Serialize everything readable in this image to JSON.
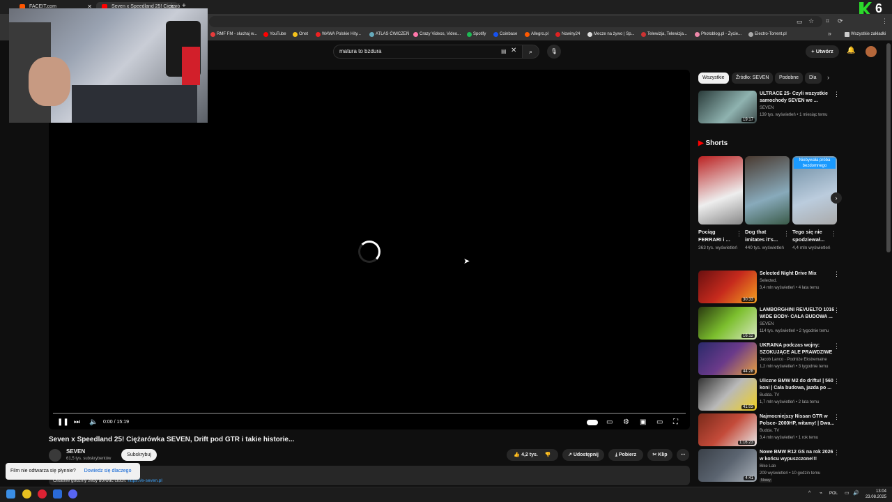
{
  "colors": {
    "accent": "#ff0000",
    "link": "#3ea6ff",
    "bg": "#0f0f0f"
  },
  "browser": {
    "tabs": [
      {
        "label": "FACEIT.com",
        "color": "#ff5500",
        "active": false
      },
      {
        "label": "Seven x Speedland 25! Ciężaró",
        "color": "#ff0000",
        "active": true
      }
    ],
    "new_tab": "+",
    "bookmarks": [
      {
        "label": "RMF FM - słuchaj w...",
        "color": "#e63b3b"
      },
      {
        "label": "YouTube",
        "color": "#ff0000"
      },
      {
        "label": "Onet",
        "color": "#f4c21b"
      },
      {
        "label": "WAWA Polskie Hity...",
        "color": "#e22"
      },
      {
        "label": "ATLAS ĆWICZEŃ",
        "color": "#6ab"
      },
      {
        "label": "Crazy Videos, Video...",
        "color": "#f7a"
      },
      {
        "label": "Spotify",
        "color": "#1db954"
      },
      {
        "label": "Coinbase",
        "color": "#1652f0"
      },
      {
        "label": "Allegro.pl",
        "color": "#ff5a00"
      },
      {
        "label": "Nowiny24",
        "color": "#d22"
      },
      {
        "label": "Mecze na żywo | Sp...",
        "color": "#ddd"
      },
      {
        "label": "Telewizja, Telewizja...",
        "color": "#c33"
      },
      {
        "label": "Photoblog.pl - Życie...",
        "color": "#e8a"
      },
      {
        "label": "Electro-Torrent.pl",
        "color": "#aaa"
      }
    ],
    "all_bookmarks": "Wszystkie zakładki"
  },
  "youtube": {
    "search_query": "matura to bzdura",
    "create_label": "Utwórz",
    "video": {
      "time": "0:00 / 15:19",
      "title": "Seven x Speedland 25! Ciężarówka SEVEN, Drift pod GTR i takie historie...",
      "channel": "SEVEN",
      "subscribers": "61,5 tys. subskrybentów",
      "subscribe": "Subskrybuj",
      "likes": "4,2 tys.",
      "share": "Udostępnij",
      "download": "Pobierz",
      "clip": "Klip",
      "description": "Ostatnie godziny żeby dorwać ciuch:",
      "description_link": "https://e-seven.pl"
    },
    "toast": {
      "text": "Film nie odtwarza się płynnie?",
      "link": "Dowiedz się dlaczego"
    },
    "chips": [
      "Wszystkie",
      "Źródło: SEVEN",
      "Podobne",
      "Dla"
    ],
    "top_video": {
      "title": "ULTRACE 25- Czyli wszystkie samochody SEVEN we ...",
      "channel": "SEVEN",
      "meta": "139 tys. wyświetleń • 1 miesiąc temu",
      "duration": "19:17"
    },
    "shorts_heading": "Shorts",
    "shorts": [
      {
        "title": "Pociąg FERRARI i ...",
        "meta": "363 tys. wyświetleń",
        "overlay": ""
      },
      {
        "title": "Dog that imitates it's...",
        "meta": "440 tys. wyświetleń",
        "overlay": ""
      },
      {
        "title": "Tego się nie spodziewał...",
        "meta": "4,4 mln wyświetleń",
        "overlay": "Niebywała próba bezdomnego"
      }
    ],
    "videos": [
      {
        "title": "Selected Night Drive Mix",
        "channel": "Selected.",
        "meta": "3,4 mln wyświetleń • 4 lata temu",
        "duration": "30:33",
        "color": "#c62a1d"
      },
      {
        "title": "LAMBORGHINI REVUELTO 1016 WIDE BODY- CAŁA BUDOWA ...",
        "channel": "SEVEN",
        "meta": "114 tys. wyświetleń • 2 tygodnie temu",
        "duration": "16:12",
        "color": "#7cbf2e"
      },
      {
        "title": "UKRAINA podczas wojny: SZOKUJĄCE ALE PRAWDZIWE",
        "channel": "Jacob Lanco · Podróże Ekstremalne",
        "meta": "1,2 mln wyświetleń • 3 tygodnie temu",
        "duration": "44:28",
        "color": "#6a3a8a"
      },
      {
        "title": "Uliczne BMW M2 do driftu! | 560 koni | Cała budowa, jazda po ...",
        "channel": "Budda. TV",
        "meta": "1,7 mln wyświetleń • 2 lata temu",
        "duration": "41:03",
        "color": "#b9b9b9"
      },
      {
        "title": "Najmocniejszy Nissan GTR w Polsce- 2000HP, witamy! | Dwa...",
        "channel": "Budda. TV",
        "meta": "3,4 mln wyświetleń • 1 rok temu",
        "duration": "1:16:23",
        "color": "#c44b3a"
      },
      {
        "title": "Nowe BMW R12 GS na rok 2026 w końcu wypuszczone!!!",
        "channel": "Bike Lab",
        "meta": "209 wyświetleń • 10 godzin temu",
        "duration": "4:41",
        "color": "#5b6470"
      }
    ],
    "new_badge": "Nowy"
  },
  "taskbar": {
    "lang": "POL",
    "time": "13:04",
    "date": "23.08.2025"
  }
}
